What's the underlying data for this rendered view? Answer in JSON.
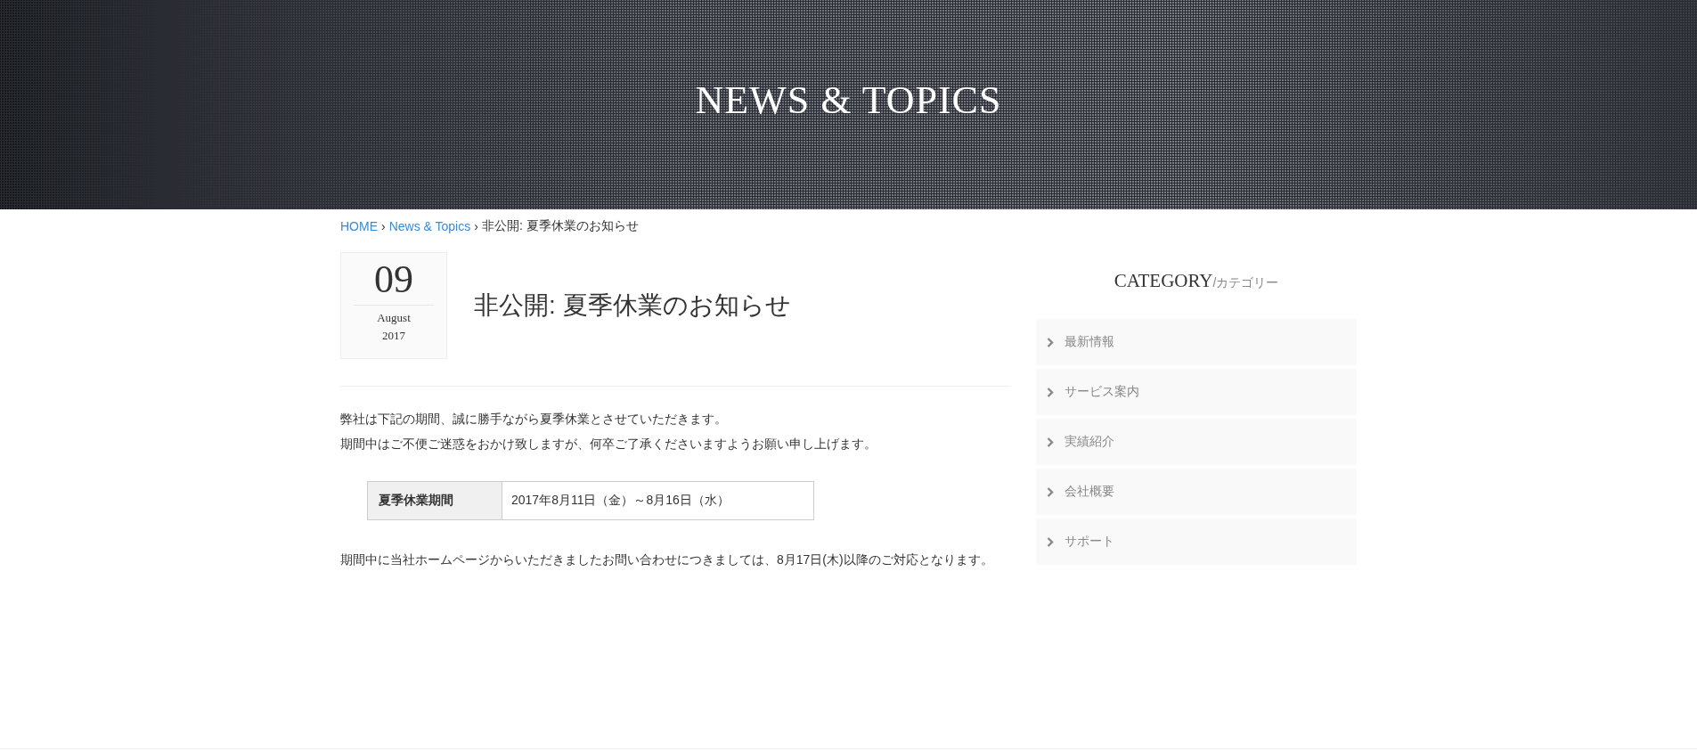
{
  "banner": {
    "title": "NEWS & TOPICS"
  },
  "breadcrumb": {
    "separator": "›",
    "links": [
      "HOME",
      "News & Topics"
    ],
    "current": "非公開: 夏季休業のお知らせ"
  },
  "post": {
    "date": {
      "day": "09",
      "month": "August",
      "year": "2017"
    },
    "title": "非公開: 夏季休業のお知らせ",
    "intro": [
      "弊社は下記の期間、誠に勝手ながら夏季休業とさせていただきます。",
      "期間中はご不便ご迷惑をおかけ致しますが、何卒ご了承くださいますようお願い申し上げます。"
    ],
    "table": [
      {
        "label": "夏季休業期間",
        "value": "2017年8月11日（金）～8月16日（水）"
      }
    ],
    "note": "期間中に当社ホームページからいただきましたお問い合わせにつきましては、8月17日(木)以降のご対応となります。"
  },
  "sidebar": {
    "heading": "CATEGORY",
    "subheading": "/カテゴリー",
    "items": [
      "最新情報",
      "サービス案内",
      "実績紹介",
      "会社概要",
      "サポート"
    ]
  }
}
